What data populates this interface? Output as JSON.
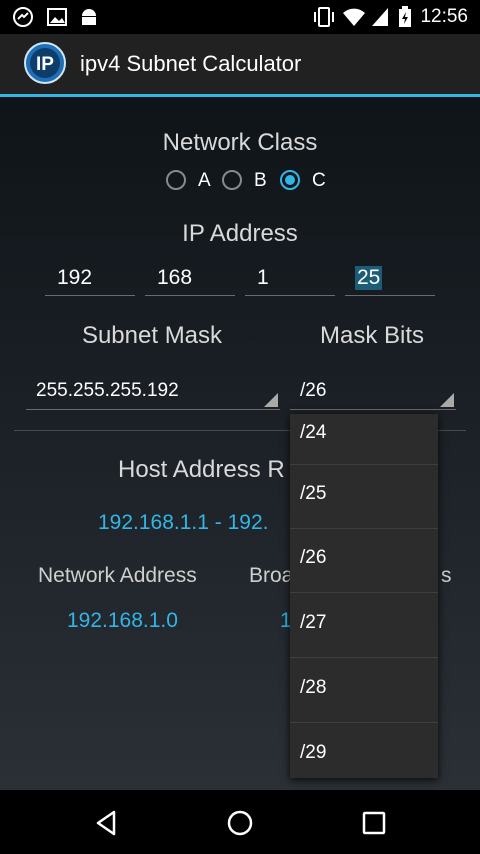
{
  "status_bar": {
    "time": "12:56",
    "left_icons": [
      "sync-icon",
      "image-icon",
      "android-icon"
    ],
    "right_icons": [
      "vibrate-icon",
      "wifi-icon",
      "signal-icon",
      "battery-charging-icon"
    ]
  },
  "app_bar": {
    "logo_text": "IP",
    "title": "ipv4 Subnet Calculator",
    "accent_color": "#33b5e5"
  },
  "network_class": {
    "title": "Network Class",
    "options": [
      {
        "label": "A",
        "checked": false
      },
      {
        "label": "B",
        "checked": false
      },
      {
        "label": "C",
        "checked": true
      }
    ]
  },
  "ip_address": {
    "title": "IP Address",
    "octets": [
      "192",
      "168",
      "1",
      "25"
    ]
  },
  "subnet_mask": {
    "title": "Subnet Mask",
    "value": "255.255.255.192"
  },
  "mask_bits": {
    "title": "Mask Bits",
    "value": "/26",
    "options": [
      "/24",
      "/25",
      "/26",
      "/27",
      "/28",
      "/29"
    ]
  },
  "host_address": {
    "title_visible": "Host Address R",
    "range_visible": "192.168.1.1 - 192."
  },
  "network_address": {
    "title": "Network Address",
    "value": "192.168.1.0"
  },
  "broadcast_address": {
    "title_left_visible": "Broa",
    "title_right_visible": "s",
    "value_visible": "1"
  },
  "nav_bar": {
    "icons": [
      "back-icon",
      "home-icon",
      "recents-icon"
    ]
  }
}
